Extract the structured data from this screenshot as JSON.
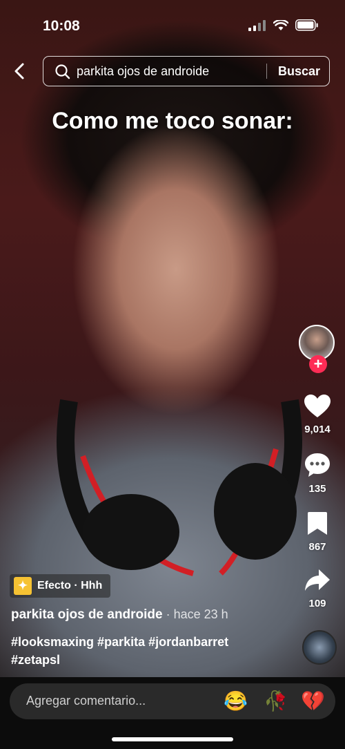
{
  "status": {
    "time": "10:08"
  },
  "search": {
    "query": "parkita ojos de androide",
    "submit_label": "Buscar"
  },
  "video": {
    "caption": "Como me toco sonar:"
  },
  "actions": {
    "likes": "9,014",
    "comments": "135",
    "saves": "867",
    "shares": "109"
  },
  "effect": {
    "label": "Efecto · Hhh"
  },
  "post": {
    "author": "parkita ojos de androide",
    "time": " · hace 23 h",
    "hashtags": "#looksmaxing #parkita #jordanbarret #zetapsl"
  },
  "comment_bar": {
    "placeholder": "Agregar comentario...",
    "emojis": [
      "😂",
      "🥀",
      "💔"
    ]
  },
  "colors": {
    "follow": "#fe2c55",
    "effect_icon": "#f6c233"
  }
}
